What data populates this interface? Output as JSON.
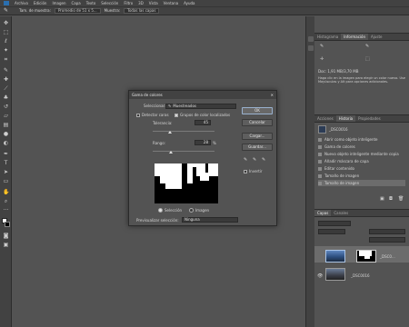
{
  "menu": [
    "Archivo",
    "Edición",
    "Imagen",
    "Capa",
    "Texto",
    "Selección",
    "Filtro",
    "3D",
    "Vista",
    "Ventana",
    "Ayuda"
  ],
  "options": {
    "sample_label": "Tam. de muestra:",
    "sample_value": "Promedio de 51 x 5...",
    "sample2_label": "Muestra:",
    "sample2_value": "Todas las capas"
  },
  "dialog": {
    "title": "Gama de colores",
    "close": "✕",
    "select_label": "Seleccionar:",
    "select_value": "Muestreados",
    "detect_faces": "Detectar caras",
    "localized": "Grupos de color localizados",
    "tolerance_label": "Tolerancia:",
    "tolerance_value": "45",
    "range_label": "Rango:",
    "range_value": "28",
    "range_unit": "%",
    "radio_selection": "Selección",
    "radio_image": "Imagen",
    "preview_label": "Previsualizar selección:",
    "preview_value": "Ninguna",
    "ok": "OK",
    "cancel": "Cancelar",
    "load": "Cargar...",
    "save": "Guardar...",
    "invert": "Invertir"
  },
  "panels": {
    "top_tabs": [
      "Histograma",
      "Información",
      "Ajuste"
    ],
    "info_text": "Haga clic en la imagen para elegir un color nuevo. Use Mayúsculas y Alt para opciones adicionales.",
    "info_doc": "Doc: 1,91 MB/3,70 MB",
    "history_tabs": [
      "Acciones",
      "Historia",
      "Propiedades"
    ],
    "history_snapshot": "_DSC0016",
    "history_items": [
      "Abrir como objeto inteligente",
      "Gama de colores",
      "Nuevo objeto inteligente mediante copia",
      "Añadir máscara de capa",
      "Editar contenido",
      "Tamaño de imagen",
      "Tamaño de imagen"
    ],
    "layers_tabs": [
      "Capas",
      "Canales"
    ],
    "layer1_name": "_DSC0...",
    "layer2_name": "_DSC0016"
  }
}
